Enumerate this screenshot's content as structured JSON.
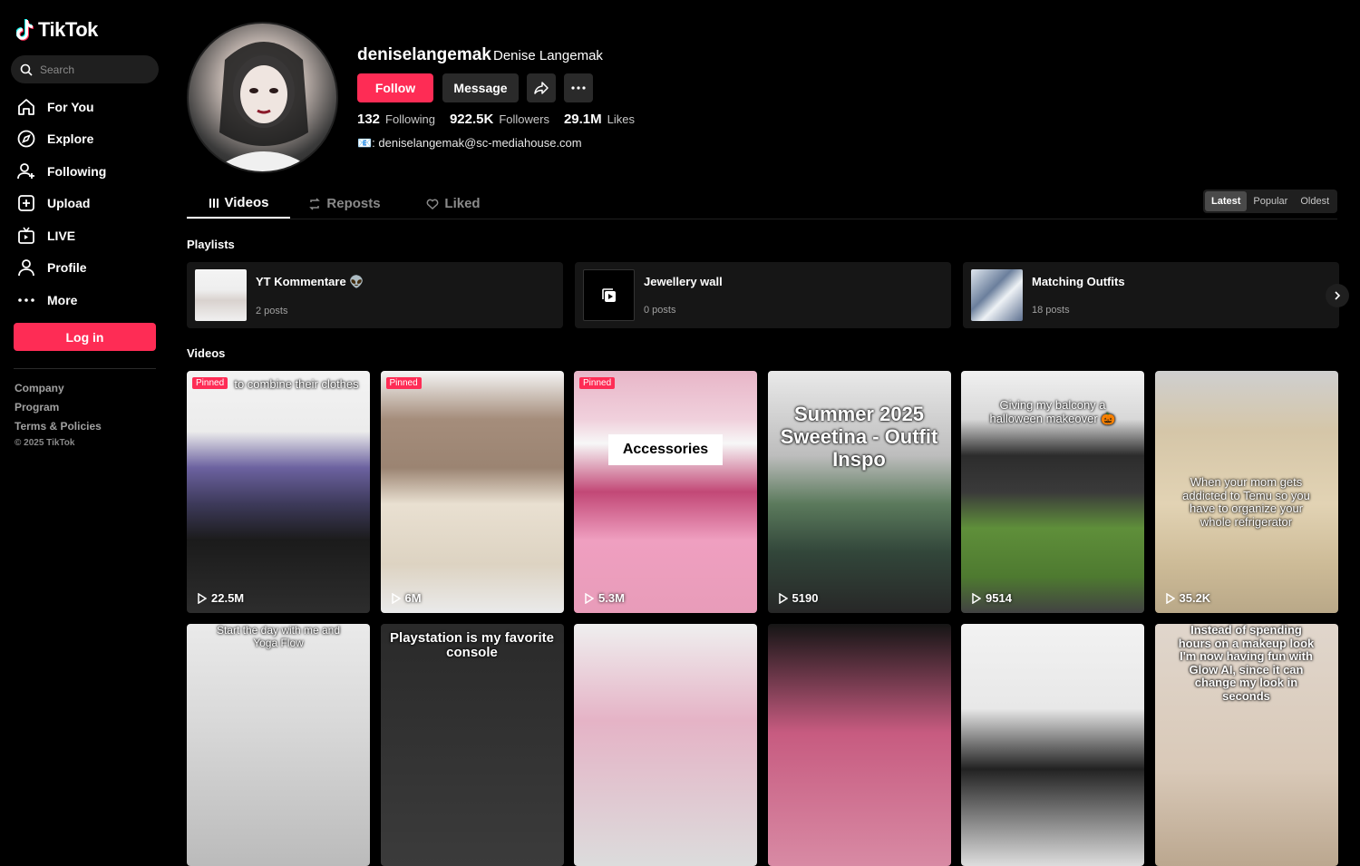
{
  "brand": {
    "name": "TikTok"
  },
  "search": {
    "placeholder": "Search"
  },
  "nav": {
    "items": [
      {
        "label": "For You",
        "icon": "home-icon"
      },
      {
        "label": "Explore",
        "icon": "compass-icon"
      },
      {
        "label": "Following",
        "icon": "user-plus-icon"
      },
      {
        "label": "Upload",
        "icon": "plus-square-icon"
      },
      {
        "label": "LIVE",
        "icon": "live-tv-icon"
      },
      {
        "label": "Profile",
        "icon": "person-icon"
      },
      {
        "label": "More",
        "icon": "ellipsis-icon"
      }
    ]
  },
  "login": {
    "label": "Log in"
  },
  "footer": {
    "links": [
      "Company",
      "Program",
      "Terms & Policies"
    ],
    "copyright": "© 2025 TikTok"
  },
  "profile": {
    "username": "deniselangemak",
    "nickname": "Denise Langemak",
    "follow_label": "Follow",
    "message_label": "Message",
    "stats": [
      {
        "value": "132",
        "label": "Following"
      },
      {
        "value": "922.5K",
        "label": "Followers"
      },
      {
        "value": "29.1M",
        "label": "Likes"
      }
    ],
    "bio": "📧: deniselangemak@sc-mediahouse.com"
  },
  "tabs": [
    {
      "label": "Videos",
      "active": true
    },
    {
      "label": "Reposts",
      "active": false
    },
    {
      "label": "Liked",
      "active": false
    }
  ],
  "sort": {
    "options": [
      "Latest",
      "Popular",
      "Oldest"
    ],
    "selected": "Latest"
  },
  "sections": {
    "playlists": "Playlists",
    "videos": "Videos"
  },
  "playlists": [
    {
      "name": "YT Kommentare 👽",
      "count": "2 posts"
    },
    {
      "name": "Jewellery wall",
      "count": "0 posts"
    },
    {
      "name": "Matching Outfits",
      "count": "18 posts"
    }
  ],
  "videos": [
    {
      "views": "22.5M",
      "pinned": "Pinned",
      "caption": "to combine their clothes"
    },
    {
      "views": "6M",
      "pinned": "Pinned",
      "caption": ""
    },
    {
      "views": "5.3M",
      "pinned": "Pinned",
      "caption": "Accessories"
    },
    {
      "views": "5190",
      "pinned": "",
      "caption": "Summer 2025 Sweetina - Outfit Inspo"
    },
    {
      "views": "9514",
      "pinned": "",
      "caption": "Giving my balcony a halloween makeover 🎃"
    },
    {
      "views": "35.2K",
      "pinned": "",
      "caption": "When your mom gets addicted to Temu so you have to organize your whole refrigerator"
    },
    {
      "views": "",
      "pinned": "",
      "caption": "Start the day with me and Yoga Flow"
    },
    {
      "views": "",
      "pinned": "",
      "caption": "Playstation is my favorite console"
    },
    {
      "views": "",
      "pinned": "",
      "caption": ""
    },
    {
      "views": "",
      "pinned": "",
      "caption": ""
    },
    {
      "views": "",
      "pinned": "",
      "caption": ""
    },
    {
      "views": "",
      "pinned": "",
      "caption": "Instead of spending hours on a makeup look I'm now having fun with Glow AI, since it can change my look in seconds"
    }
  ],
  "colors": {
    "accent": "#fe2c55",
    "background": "#000000",
    "surface": "#161616"
  }
}
